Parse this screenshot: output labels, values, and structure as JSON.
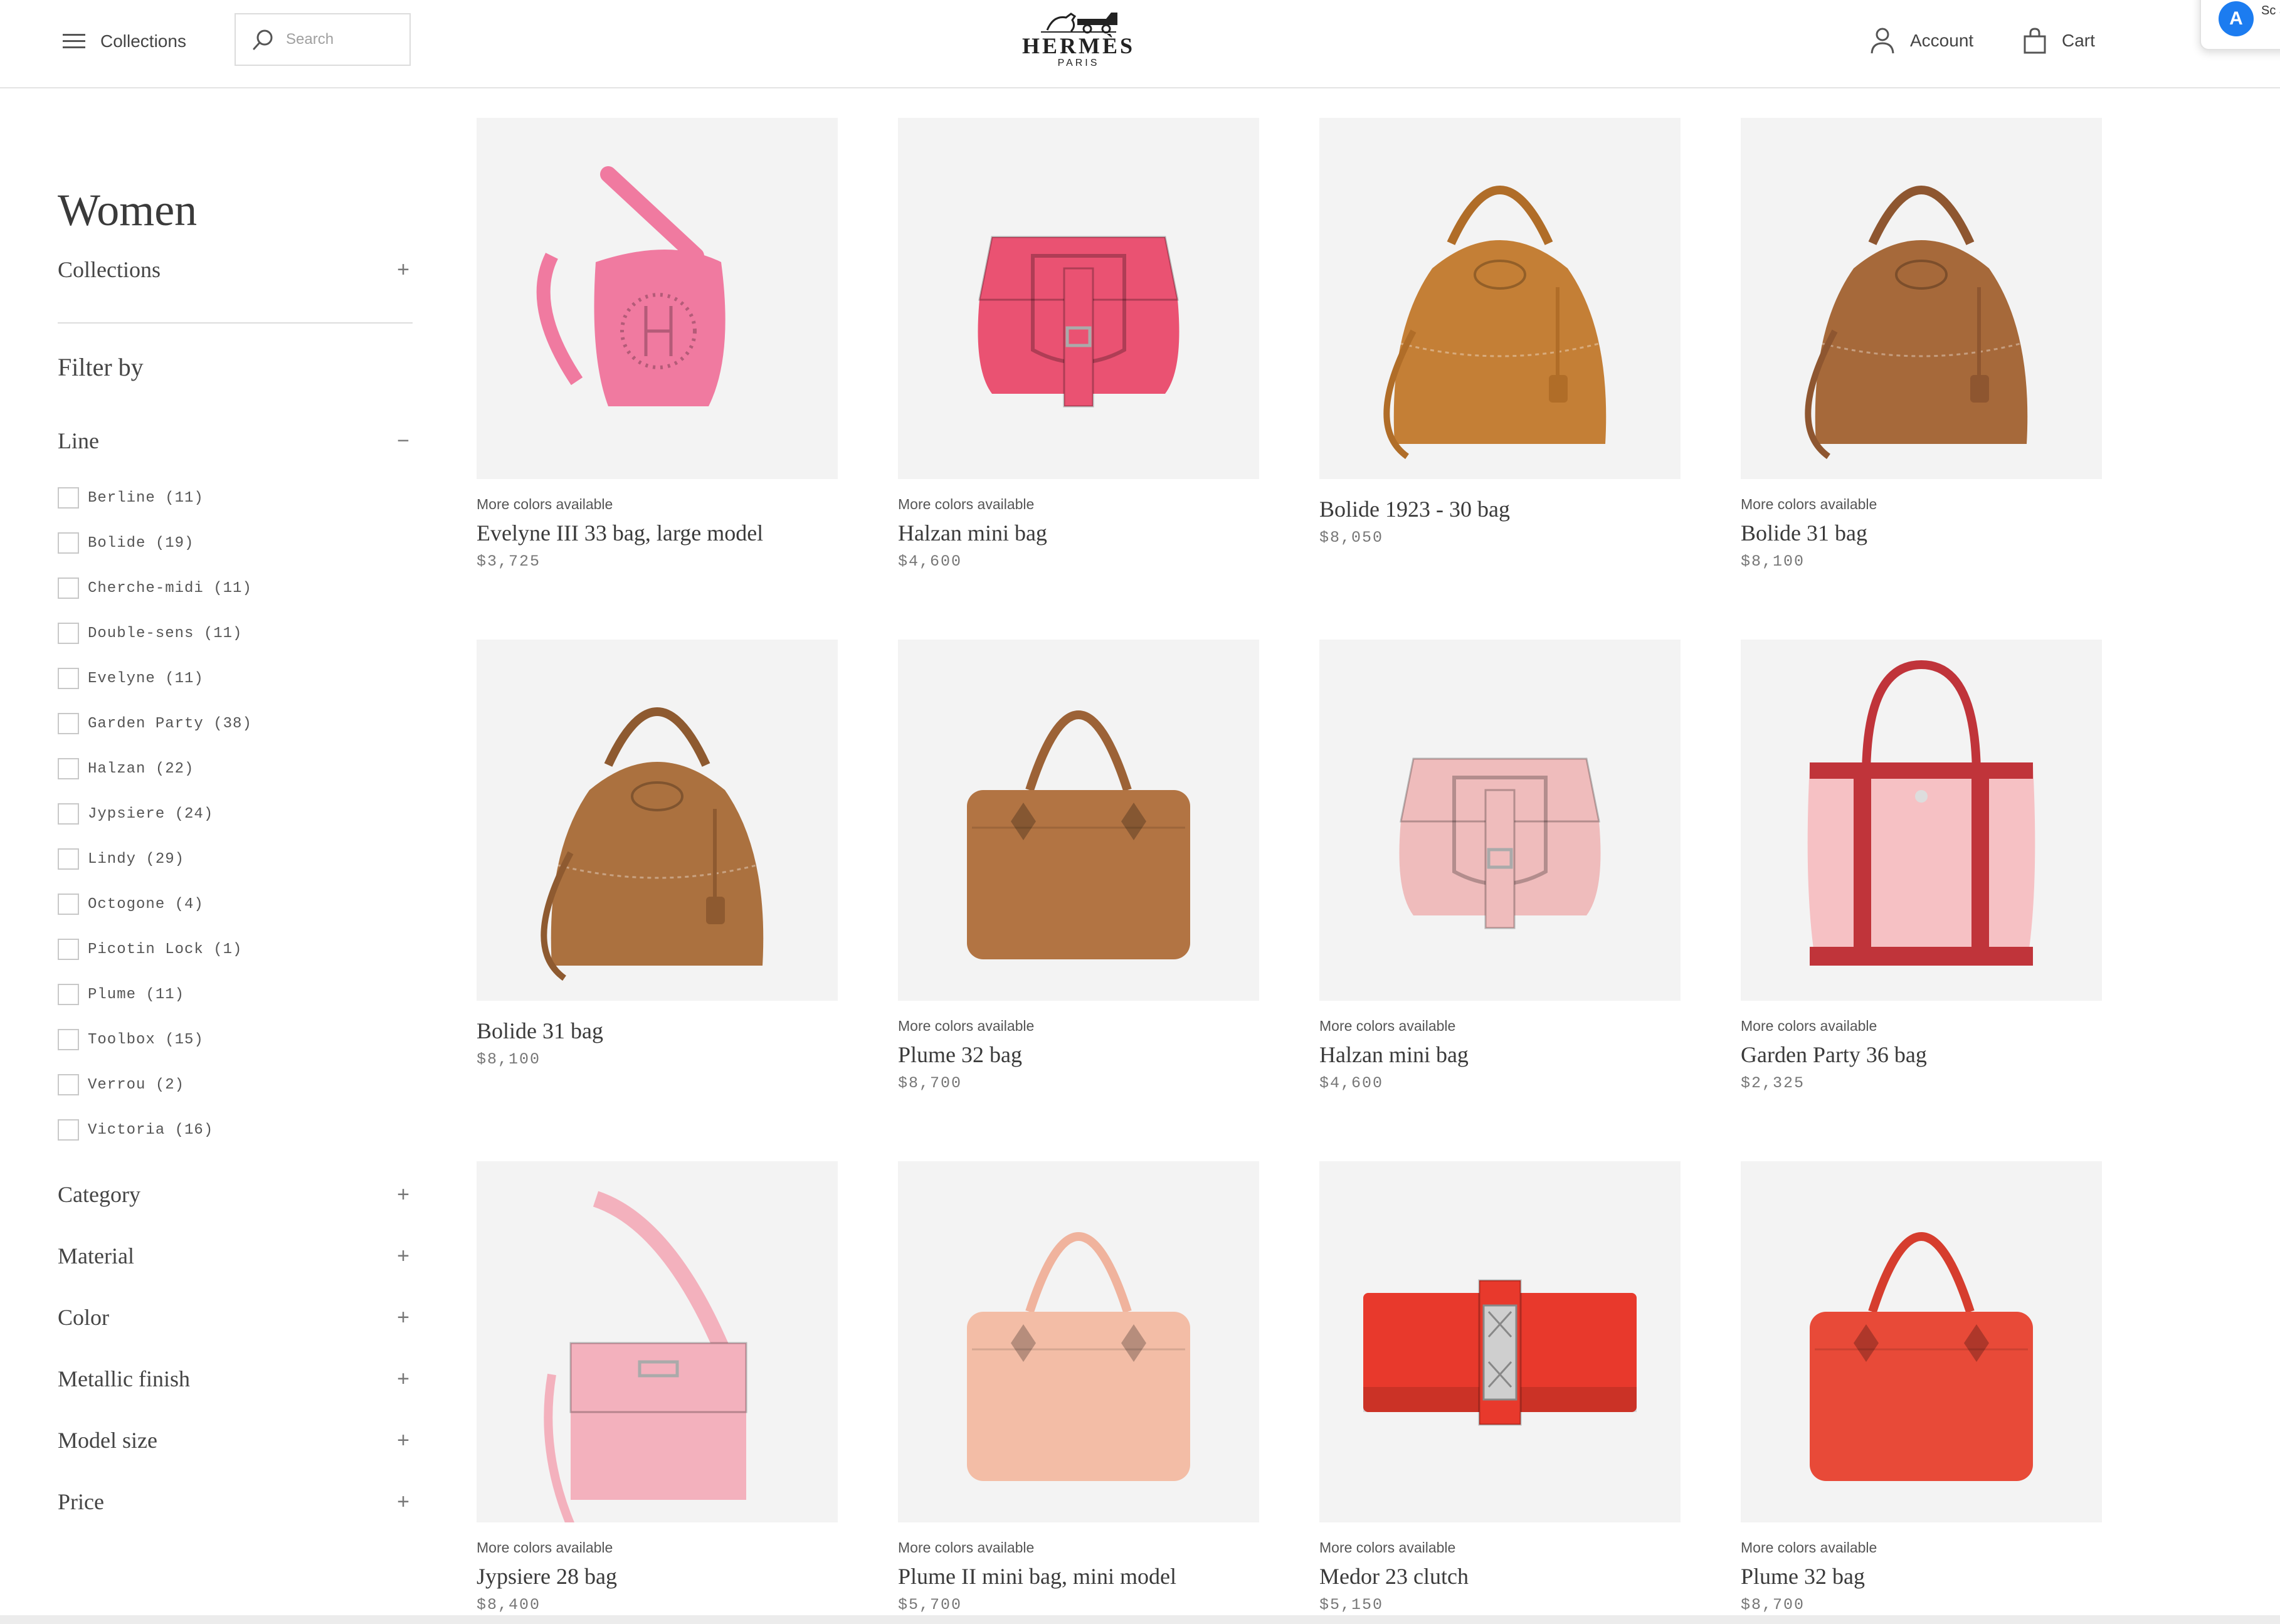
{
  "header": {
    "menu_label": "Collections",
    "search_placeholder": "Search",
    "logo_name": "HERMÈS",
    "logo_sub": "PARIS",
    "account_label": "Account",
    "cart_label": "Cart",
    "popup_text": "Sc au"
  },
  "sidebar": {
    "title": "Women",
    "collections_label": "Collections",
    "filter_by": "Filter by",
    "line_label": "Line",
    "line_items": [
      {
        "label": "Berline (11)"
      },
      {
        "label": "Bolide (19)"
      },
      {
        "label": "Cherche-midi (11)"
      },
      {
        "label": "Double-sens (11)"
      },
      {
        "label": "Evelyne (11)"
      },
      {
        "label": "Garden Party (38)"
      },
      {
        "label": "Halzan (22)"
      },
      {
        "label": "Jypsiere (24)"
      },
      {
        "label": "Lindy (29)"
      },
      {
        "label": "Octogone (4)"
      },
      {
        "label": "Picotin Lock (1)"
      },
      {
        "label": "Plume (11)"
      },
      {
        "label": "Toolbox (15)"
      },
      {
        "label": "Verrou (2)"
      },
      {
        "label": "Victoria (16)"
      }
    ],
    "facets": [
      {
        "label": "Category"
      },
      {
        "label": "Material"
      },
      {
        "label": "Color"
      },
      {
        "label": "Metallic finish"
      },
      {
        "label": "Model size"
      },
      {
        "label": "Price"
      }
    ]
  },
  "products": [
    {
      "colors": "More colors available",
      "name": "Evelyne III 33 bag, large model",
      "price": "$3,725",
      "bag": "evelyne",
      "color": "#f07aa0",
      "strap": "#f07aa0"
    },
    {
      "colors": "More colors available",
      "name": "Halzan mini bag",
      "price": "$4,600",
      "bag": "halzan",
      "color": "#ea5272",
      "strap": "#ea5272"
    },
    {
      "colors": "",
      "name": "Bolide 1923 - 30 bag",
      "price": "$8,050",
      "bag": "bolide",
      "color": "#c47f36",
      "strap": "#b06d28"
    },
    {
      "colors": "More colors available",
      "name": "Bolide 31 bag",
      "price": "$8,100",
      "bag": "bolide",
      "color": "#a6693a",
      "strap": "#8e5630"
    },
    {
      "colors": "",
      "name": "Bolide 31 bag",
      "price": "$8,100",
      "bag": "bolide",
      "color": "#ab713f",
      "strap": "#8e5a30"
    },
    {
      "colors": "More colors available",
      "name": "Plume 32 bag",
      "price": "$8,700",
      "bag": "plume",
      "color": "#b27443",
      "strap": "#9c6236"
    },
    {
      "colors": "More colors available",
      "name": "Halzan mini bag",
      "price": "$4,600",
      "bag": "halzan",
      "color": "#efbcbc",
      "strap": "#efbcbc"
    },
    {
      "colors": "More colors available",
      "name": "Garden Party 36 bag",
      "price": "$2,325",
      "bag": "garden",
      "color": "#f6c1c4",
      "strap": "#c0343a"
    },
    {
      "colors": "More colors available",
      "name": "Jypsiere 28 bag",
      "price": "$8,400",
      "bag": "jypsiere",
      "color": "#f3b1bd",
      "strap": "#f3b1bd"
    },
    {
      "colors": "More colors available",
      "name": "Plume II mini bag, mini model",
      "price": "$5,700",
      "bag": "plume",
      "color": "#f3bda6",
      "strap": "#f0b39d"
    },
    {
      "colors": "More colors available",
      "name": "Medor 23 clutch",
      "price": "$5,150",
      "bag": "clutch",
      "color": "#e8392c",
      "strap": "#e8392c"
    },
    {
      "colors": "More colors available",
      "name": "Plume 32 bag",
      "price": "$8,700",
      "bag": "plume",
      "color": "#e84a38",
      "strap": "#d63d2e"
    }
  ]
}
